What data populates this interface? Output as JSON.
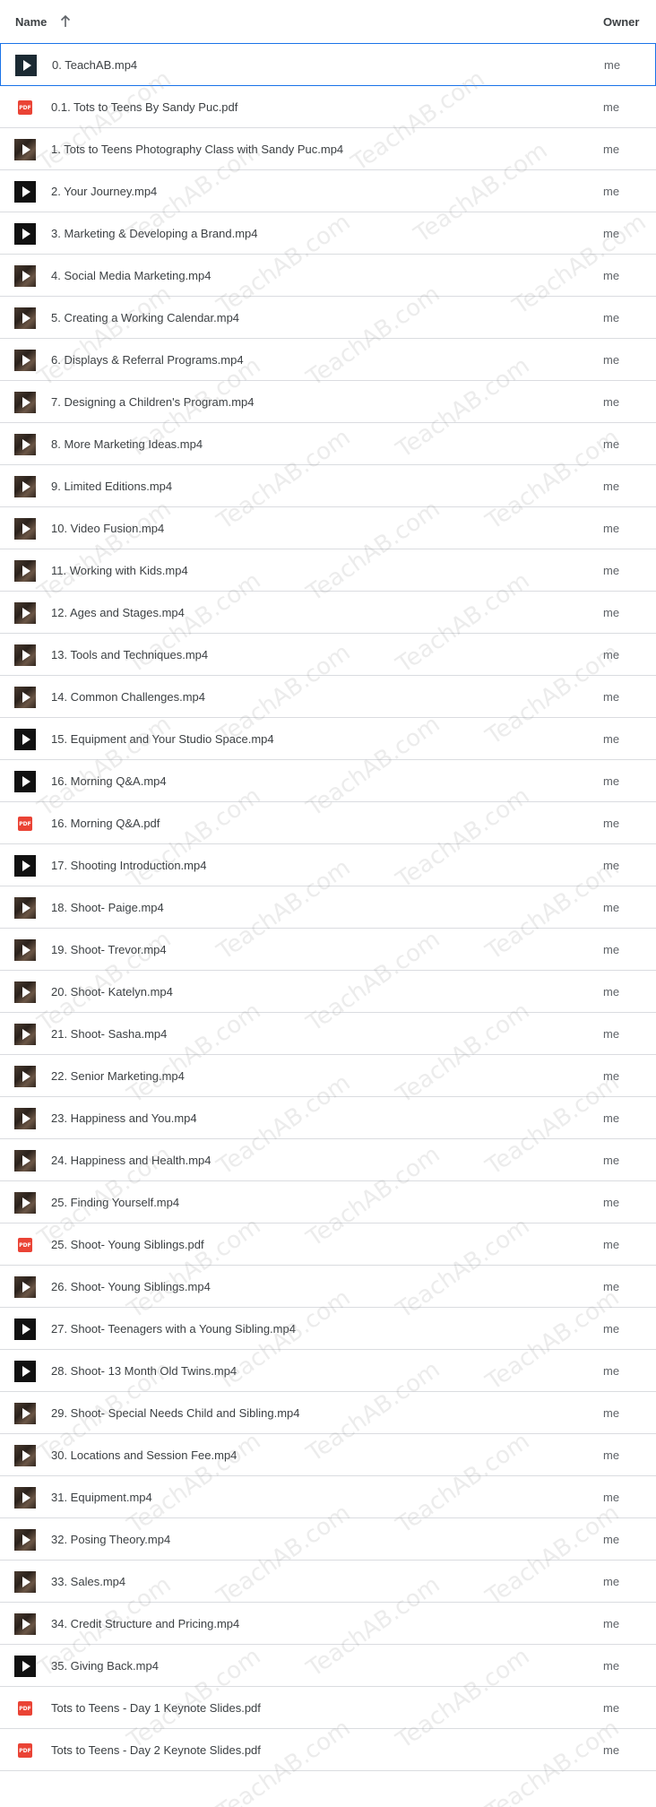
{
  "header": {
    "name_label": "Name",
    "owner_label": "Owner"
  },
  "watermark_text": "TeachAB.com",
  "files": [
    {
      "name": "0. TeachAB.mp4",
      "owner": "me",
      "icon": "video-selected"
    },
    {
      "name": "0.1. Tots to Teens By Sandy Puc.pdf",
      "owner": "me",
      "icon": "pdf"
    },
    {
      "name": "1. Tots to Teens Photography Class with Sandy Puc.mp4",
      "owner": "me",
      "icon": "video-photo"
    },
    {
      "name": "2. Your Journey.mp4",
      "owner": "me",
      "icon": "video-dark"
    },
    {
      "name": "3. Marketing & Developing a Brand.mp4",
      "owner": "me",
      "icon": "video-dark"
    },
    {
      "name": "4. Social Media Marketing.mp4",
      "owner": "me",
      "icon": "video-photo"
    },
    {
      "name": "5. Creating a Working Calendar.mp4",
      "owner": "me",
      "icon": "video-photo"
    },
    {
      "name": "6. Displays & Referral Programs.mp4",
      "owner": "me",
      "icon": "video-photo"
    },
    {
      "name": "7. Designing a Children's Program.mp4",
      "owner": "me",
      "icon": "video-photo"
    },
    {
      "name": "8. More Marketing Ideas.mp4",
      "owner": "me",
      "icon": "video-photo"
    },
    {
      "name": "9. Limited Editions.mp4",
      "owner": "me",
      "icon": "video-photo"
    },
    {
      "name": "10. Video Fusion.mp4",
      "owner": "me",
      "icon": "video-photo"
    },
    {
      "name": "11. Working with Kids.mp4",
      "owner": "me",
      "icon": "video-photo"
    },
    {
      "name": "12. Ages and Stages.mp4",
      "owner": "me",
      "icon": "video-photo"
    },
    {
      "name": "13. Tools and Techniques.mp4",
      "owner": "me",
      "icon": "video-photo"
    },
    {
      "name": "14. Common Challenges.mp4",
      "owner": "me",
      "icon": "video-photo"
    },
    {
      "name": "15. Equipment and Your Studio Space.mp4",
      "owner": "me",
      "icon": "video-dark"
    },
    {
      "name": "16. Morning Q&A.mp4",
      "owner": "me",
      "icon": "video-dark"
    },
    {
      "name": "16. Morning Q&A.pdf",
      "owner": "me",
      "icon": "pdf"
    },
    {
      "name": "17. Shooting Introduction.mp4",
      "owner": "me",
      "icon": "video-dark"
    },
    {
      "name": "18. Shoot- Paige.mp4",
      "owner": "me",
      "icon": "video-photo"
    },
    {
      "name": "19. Shoot- Trevor.mp4",
      "owner": "me",
      "icon": "video-photo"
    },
    {
      "name": "20. Shoot- Katelyn.mp4",
      "owner": "me",
      "icon": "video-photo"
    },
    {
      "name": "21. Shoot- Sasha.mp4",
      "owner": "me",
      "icon": "video-photo"
    },
    {
      "name": "22. Senior Marketing.mp4",
      "owner": "me",
      "icon": "video-photo"
    },
    {
      "name": "23. Happiness and You.mp4",
      "owner": "me",
      "icon": "video-photo"
    },
    {
      "name": "24. Happiness and Health.mp4",
      "owner": "me",
      "icon": "video-photo"
    },
    {
      "name": "25. Finding Yourself.mp4",
      "owner": "me",
      "icon": "video-photo"
    },
    {
      "name": "25. Shoot- Young Siblings.pdf",
      "owner": "me",
      "icon": "pdf"
    },
    {
      "name": "26. Shoot- Young Siblings.mp4",
      "owner": "me",
      "icon": "video-photo"
    },
    {
      "name": "27. Shoot- Teenagers with a Young Sibling.mp4",
      "owner": "me",
      "icon": "video-dark"
    },
    {
      "name": "28. Shoot- 13 Month Old Twins.mp4",
      "owner": "me",
      "icon": "video-dark"
    },
    {
      "name": "29. Shoot- Special Needs Child and Sibling.mp4",
      "owner": "me",
      "icon": "video-photo"
    },
    {
      "name": "30. Locations and Session Fee.mp4",
      "owner": "me",
      "icon": "video-photo"
    },
    {
      "name": "31. Equipment.mp4",
      "owner": "me",
      "icon": "video-photo"
    },
    {
      "name": "32. Posing Theory.mp4",
      "owner": "me",
      "icon": "video-photo"
    },
    {
      "name": "33. Sales.mp4",
      "owner": "me",
      "icon": "video-photo"
    },
    {
      "name": "34. Credit Structure and Pricing.mp4",
      "owner": "me",
      "icon": "video-photo"
    },
    {
      "name": "35. Giving Back.mp4",
      "owner": "me",
      "icon": "video-dark"
    },
    {
      "name": "Tots to Teens - Day 1 Keynote Slides.pdf",
      "owner": "me",
      "icon": "pdf"
    },
    {
      "name": "Tots to Teens - Day 2 Keynote Slides.pdf",
      "owner": "me",
      "icon": "pdf"
    }
  ],
  "pdf_badge_text": "PDF"
}
